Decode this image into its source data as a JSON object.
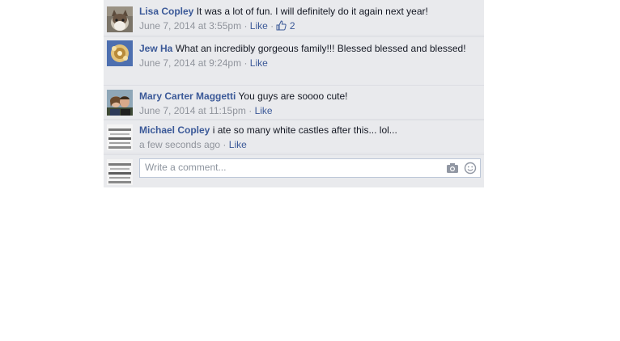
{
  "comments": [
    {
      "author": "Lisa Copley",
      "text": "It was a lot of fun. I will definitely do it again next year!",
      "time": "June 7, 2014 at 3:55pm",
      "like": "Like",
      "likes": "2",
      "avatar": "cat"
    },
    {
      "author": "Jew Ha",
      "text": "What an incredibly gorgeous family!!! Blessed blessed and blessed!",
      "time": "June 7, 2014 at 9:24pm",
      "like": "Like",
      "likes": "",
      "avatar": "gold-flower"
    },
    {
      "author": "Mary Carter Maggetti",
      "text": "You guys are soooo cute!",
      "time": "June 7, 2014 at 11:15pm",
      "like": "Like",
      "likes": "",
      "avatar": "couple"
    },
    {
      "author": "Michael Copley",
      "text": "i ate so many white castles after this... lol...",
      "time": "a few seconds ago",
      "like": "Like",
      "likes": "",
      "avatar": "stack"
    }
  ],
  "meta_separator": "·",
  "reply": {
    "placeholder": "Write a comment...",
    "camera_icon": "camera-icon",
    "emoji_icon": "smiley-icon"
  },
  "colors": {
    "link": "#3b5998",
    "meta": "#90949c",
    "panel": "#e9eaed"
  }
}
